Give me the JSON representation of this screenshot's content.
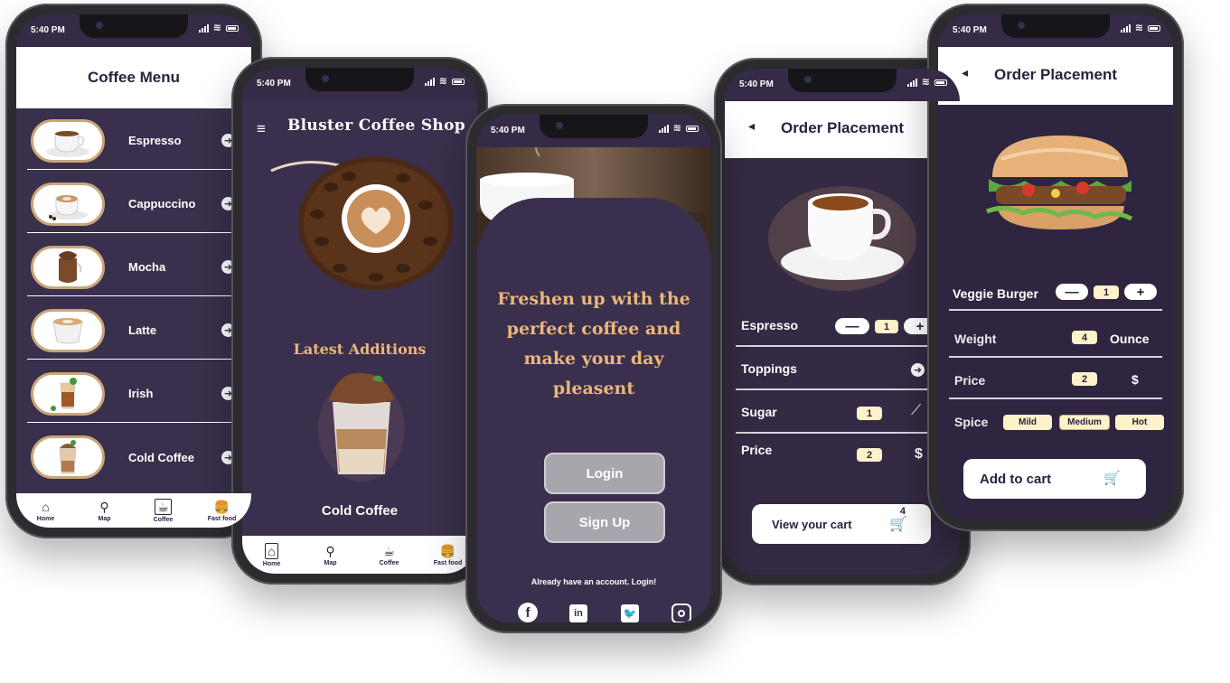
{
  "status": {
    "time": "5:40 PM"
  },
  "menu_screen": {
    "title": "Coffee Menu",
    "items": [
      {
        "label": "Espresso"
      },
      {
        "label": "Cappuccino"
      },
      {
        "label": "Mocha"
      },
      {
        "label": "Latte"
      },
      {
        "label": "Irish"
      },
      {
        "label": "Cold Coffee"
      }
    ],
    "tabs": [
      "Home",
      "Map",
      "Coffee",
      "Fast food"
    ]
  },
  "home_screen": {
    "title": "Bluster Coffee Shop",
    "section": "Latest Additions",
    "featured": "Cold Coffee",
    "tabs": [
      "Home",
      "Map",
      "Coffee",
      "Fast food"
    ]
  },
  "login_screen": {
    "headline": "Freshen up with the perfect coffee and make your day pleasent",
    "login": "Login",
    "signup": "Sign Up",
    "already": "Already have an account.  Login!"
  },
  "order_coffee": {
    "title": "Order Placement",
    "item": "Espresso",
    "qty": "1",
    "toppings": "Toppings",
    "sugar_label": "Sugar",
    "sugar": "1",
    "price_label": "Price",
    "price": "2",
    "currency": "$",
    "cart": "View your cart",
    "cart_count": "4"
  },
  "order_burger": {
    "title": "Order Placement",
    "item": "Veggie Burger",
    "qty": "1",
    "weight_label": "Weight",
    "weight": "4",
    "unit": "Ounce",
    "price_label": "Price",
    "price": "2",
    "currency": "$",
    "spice_label": "Spice",
    "spice": [
      "Mild",
      "Medium",
      "Hot"
    ],
    "add": "Add to cart"
  }
}
